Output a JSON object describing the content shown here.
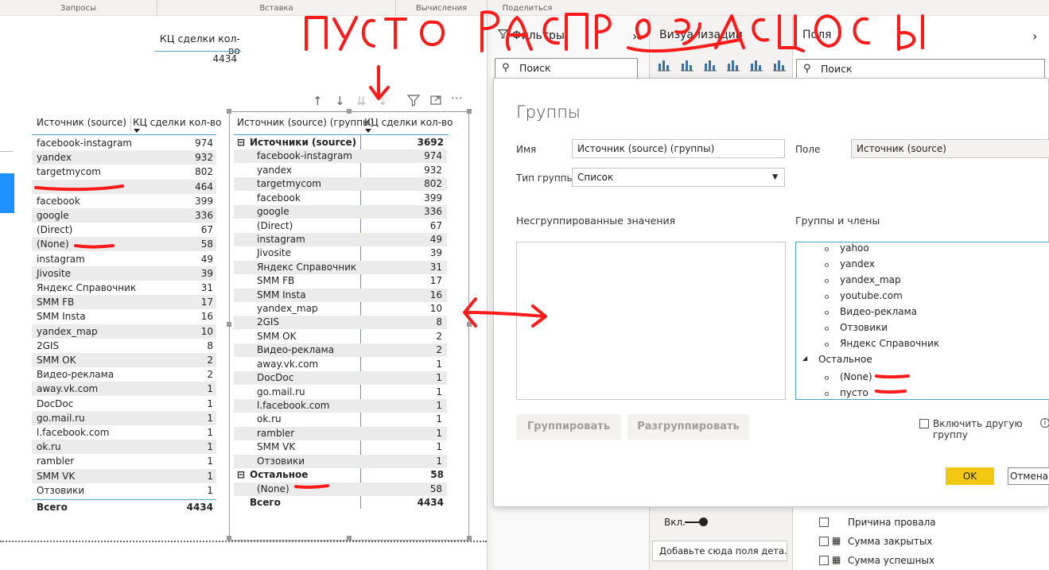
{
  "ribbon": {
    "sections": [
      "Запросы",
      "Вставка",
      "Вычисления",
      "Поделиться"
    ]
  },
  "card": {
    "label": "КЦ сделки кол-во",
    "value": "4434"
  },
  "table1": {
    "col1": "Источник (source)",
    "col2": "КЦ сделки кол-во",
    "rows": [
      {
        "name": "facebook-instagram",
        "value": "974"
      },
      {
        "name": "yandex",
        "value": "932"
      },
      {
        "name": "targetmycom",
        "value": "802"
      },
      {
        "name": "",
        "value": "464"
      },
      {
        "name": "facebook",
        "value": "399"
      },
      {
        "name": "google",
        "value": "336"
      },
      {
        "name": "(Direct)",
        "value": "67"
      },
      {
        "name": "(None)",
        "value": "58"
      },
      {
        "name": "instagram",
        "value": "49"
      },
      {
        "name": "Jivosite",
        "value": "39"
      },
      {
        "name": "Яндекс Справочник",
        "value": "31"
      },
      {
        "name": "SMM FB",
        "value": "17"
      },
      {
        "name": "SMM Insta",
        "value": "16"
      },
      {
        "name": "yandex_map",
        "value": "10"
      },
      {
        "name": "2GIS",
        "value": "8"
      },
      {
        "name": "SMM OK",
        "value": "2"
      },
      {
        "name": "Видео-реклама",
        "value": "2"
      },
      {
        "name": "away.vk.com",
        "value": "1"
      },
      {
        "name": "DocDoc",
        "value": "1"
      },
      {
        "name": "go.mail.ru",
        "value": "1"
      },
      {
        "name": "l.facebook.com",
        "value": "1"
      },
      {
        "name": "ok.ru",
        "value": "1"
      },
      {
        "name": "rambler",
        "value": "1"
      },
      {
        "name": "SMM VK",
        "value": "1"
      },
      {
        "name": "Отзовики",
        "value": "1"
      }
    ],
    "total_label": "Всего",
    "total_value": "4434"
  },
  "table2": {
    "col1": "Источник (source) (группы)",
    "col2": "КЦ сделки кол-во",
    "group1": {
      "name": "Источники (source)",
      "value": "3692",
      "collapse": "⊟"
    },
    "group1_rows": [
      {
        "name": "facebook-instagram",
        "value": "974"
      },
      {
        "name": "yandex",
        "value": "932"
      },
      {
        "name": "targetmycom",
        "value": "802"
      },
      {
        "name": "facebook",
        "value": "399"
      },
      {
        "name": "google",
        "value": "336"
      },
      {
        "name": "(Direct)",
        "value": "67"
      },
      {
        "name": "instagram",
        "value": "49"
      },
      {
        "name": "Jivosite",
        "value": "39"
      },
      {
        "name": "Яндекс Справочник",
        "value": "31"
      },
      {
        "name": "SMM FB",
        "value": "17"
      },
      {
        "name": "SMM Insta",
        "value": "16"
      },
      {
        "name": "yandex_map",
        "value": "10"
      },
      {
        "name": "2GIS",
        "value": "8"
      },
      {
        "name": "SMM OK",
        "value": "2"
      },
      {
        "name": "Видео-реклама",
        "value": "2"
      },
      {
        "name": "away.vk.com",
        "value": "1"
      },
      {
        "name": "DocDoc",
        "value": "1"
      },
      {
        "name": "go.mail.ru",
        "value": "1"
      },
      {
        "name": "l.facebook.com",
        "value": "1"
      },
      {
        "name": "ok.ru",
        "value": "1"
      },
      {
        "name": "rambler",
        "value": "1"
      },
      {
        "name": "SMM VK",
        "value": "1"
      },
      {
        "name": "Отзовики",
        "value": "1"
      }
    ],
    "group2": {
      "name": "Остальное",
      "value": "58",
      "collapse": "⊟"
    },
    "group2_rows": [
      {
        "name": "(None)",
        "value": "58"
      }
    ],
    "total_label": "Всего",
    "total_value": "4434"
  },
  "toolbar_icons": [
    "arrow-up-icon",
    "arrow-down-icon",
    "double-arrow-down-icon",
    "expand-down-icon",
    "filter-icon",
    "focus-mode-icon",
    "more-options-icon"
  ],
  "panes": {
    "filters_title": "Фильтры",
    "viz_title": "Визуализации",
    "fields_title": "Поля",
    "search_placeholder": "Поиск",
    "fields_search_placeholder": "Поиск",
    "chevron": "›"
  },
  "dialog": {
    "title": "Группы",
    "name_label": "Имя",
    "name_value": "Источник (source) (группы)",
    "field_label": "Поле",
    "field_value": "Источник (source)",
    "type_label": "Тип группы",
    "type_value": "Список",
    "ungrouped_label": "Несгруппированные значения",
    "groups_label": "Группы и члены",
    "members": [
      "yahoo",
      "yandex",
      "yandex_map",
      "youtube.com",
      "Видео-реклама",
      "Отзовики",
      "Яндекс Справочник"
    ],
    "other_group": "Остальное",
    "other_members": [
      "(None)",
      "пусто"
    ],
    "group_button": "Группировать",
    "ungroup_button": "Разгруппировать",
    "include_other_label": "Включить другую группу",
    "ok_button": "OK",
    "cancel_button": "Отмена"
  },
  "below_dialog": {
    "toggle_label": "Вкл.",
    "drill_hint": "Добавьте сюда поля дета...",
    "fields": [
      "Причина провала",
      "Сумма закрытых",
      "Сумма успешных"
    ]
  },
  "annotation": {
    "handwriting": "пусто распределилось"
  },
  "colors": {
    "accent_line": "#4da3c7",
    "ink": "#ff0000",
    "ok_yellow": "#f2c811",
    "blue_accent": "#1e90ff"
  }
}
